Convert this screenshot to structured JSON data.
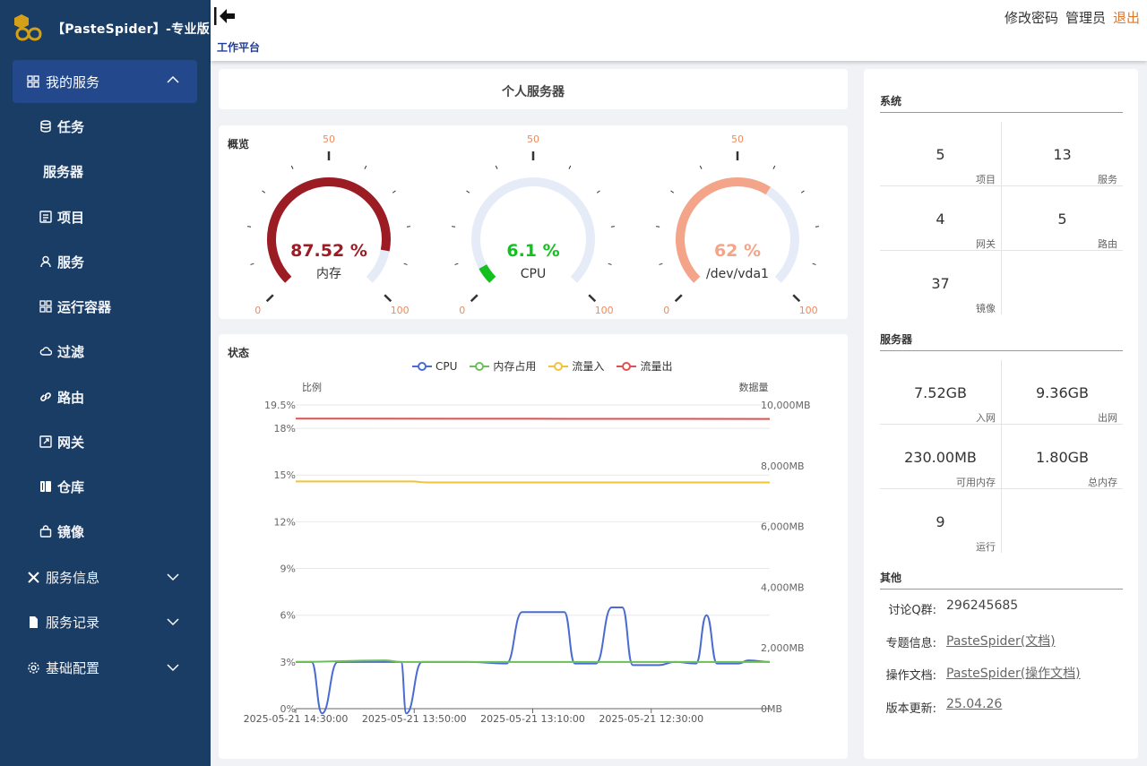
{
  "brand": {
    "title": "【PasteSpider】-专业版",
    "logo_color": "#d4a017"
  },
  "sidebar": {
    "group": {
      "label": "我的服务",
      "icon": "grid-icon"
    },
    "items": [
      {
        "label": "任务",
        "icon": "database-icon"
      },
      {
        "label": "服务器",
        "icon": ""
      },
      {
        "label": "项目",
        "icon": "list-icon"
      },
      {
        "label": "服务",
        "icon": "person-icon"
      },
      {
        "label": "运行容器",
        "icon": "grid-icon"
      },
      {
        "label": "过滤",
        "icon": "cloud-icon"
      },
      {
        "label": "路由",
        "icon": "link-icon"
      },
      {
        "label": "网关",
        "icon": "external-icon"
      },
      {
        "label": "仓库",
        "icon": "book-icon"
      },
      {
        "label": "镜像",
        "icon": "bag-icon"
      }
    ],
    "sections": [
      {
        "label": "服务信息",
        "icon": "tools-icon"
      },
      {
        "label": "服务记录",
        "icon": "file-icon"
      },
      {
        "label": "基础配置",
        "icon": "gear-icon"
      }
    ],
    "bg_color": "#1a3d66",
    "active_color": "#23488b"
  },
  "topbar": {
    "breadcrumb": "工作平台",
    "links": {
      "change_password": "修改密码",
      "admin": "管理员",
      "logout": "退出"
    }
  },
  "server_card": {
    "title": "个人服务器"
  },
  "overview": {
    "title": "概览",
    "gauges": [
      {
        "value": "87.52 %",
        "percent": 87.52,
        "name": "内存",
        "color": "#9c1c24",
        "min": "0",
        "mid": "50",
        "max": "100"
      },
      {
        "value": "6.1 %",
        "percent": 6.1,
        "name": "CPU",
        "color": "#12c01f",
        "min": "0",
        "mid": "50",
        "max": "100"
      },
      {
        "value": "62 %",
        "percent": 62,
        "name": "/dev/vda1",
        "color": "#f4a488",
        "min": "0",
        "mid": "50",
        "max": "100"
      }
    ]
  },
  "status": {
    "title": "状态",
    "chart_data": {
      "type": "line",
      "y_left_label": "比例",
      "y_right_label": "数据量",
      "y_left_ticks": [
        "0%",
        "3%",
        "6%",
        "9%",
        "12%",
        "15%",
        "18%",
        "19.5%"
      ],
      "y_left_range": [
        0,
        19.5
      ],
      "y_right_ticks": [
        "0MB",
        "2,000MB",
        "4,000MB",
        "6,000MB",
        "8,000MB",
        "10,000MB"
      ],
      "y_right_range": [
        0,
        10000
      ],
      "x_ticks": [
        "2025-05-21 14:30:00",
        "2025-05-21 13:50:00",
        "2025-05-21 13:10:00",
        "2025-05-21 12:30:00"
      ],
      "x_count": 90,
      "grid": true,
      "legend_position": "top-center",
      "series": [
        {
          "name": "CPU",
          "color": "#4a6bd0",
          "axis": "left",
          "points": [
            [
              0,
              3.0
            ],
            [
              3,
              3.0
            ],
            [
              5,
              -0.3
            ],
            [
              8,
              3.0
            ],
            [
              13,
              3.0
            ],
            [
              20,
              3.0
            ],
            [
              21,
              -0.3
            ],
            [
              24,
              3.0
            ],
            [
              33,
              3.0
            ],
            [
              40,
              2.9
            ],
            [
              43,
              6.2
            ],
            [
              51,
              6.2
            ],
            [
              53,
              2.9
            ],
            [
              57,
              2.9
            ],
            [
              60,
              6.5
            ],
            [
              62,
              6.5
            ],
            [
              64,
              2.8
            ],
            [
              69,
              2.8
            ],
            [
              72,
              3.0
            ],
            [
              76,
              2.9
            ],
            [
              78,
              6.0
            ],
            [
              80,
              2.9
            ],
            [
              84,
              2.9
            ],
            [
              86,
              3.1
            ],
            [
              90,
              3.0
            ]
          ]
        },
        {
          "name": "内存占用",
          "color": "#6cbf5a",
          "axis": "left",
          "points": [
            [
              0,
              3.0
            ],
            [
              17,
              3.1
            ],
            [
              20,
              3.0
            ],
            [
              90,
              3.0
            ]
          ]
        },
        {
          "name": "流量入",
          "color": "#f2c23b",
          "axis": "right",
          "points": [
            [
              0,
              7480
            ],
            [
              22,
              7480
            ],
            [
              25,
              7450
            ],
            [
              90,
              7450
            ]
          ]
        },
        {
          "name": "流量出",
          "color": "#e05050",
          "axis": "right",
          "points": [
            [
              0,
              9550
            ],
            [
              90,
              9540
            ]
          ]
        }
      ]
    }
  },
  "system": {
    "title": "系统",
    "stats": [
      {
        "value": "5",
        "label": "项目"
      },
      {
        "value": "13",
        "label": "服务"
      },
      {
        "value": "4",
        "label": "网关"
      },
      {
        "value": "5",
        "label": "路由"
      },
      {
        "value": "37",
        "label": "镜像"
      }
    ]
  },
  "server": {
    "title": "服务器",
    "stats": [
      {
        "value": "7.52GB",
        "label": "入网"
      },
      {
        "value": "9.36GB",
        "label": "出网"
      },
      {
        "value": "230.00MB",
        "label": "可用内存"
      },
      {
        "value": "1.80GB",
        "label": "总内存"
      },
      {
        "value": "9",
        "label": "运行"
      }
    ]
  },
  "other": {
    "title": "其他",
    "rows": [
      {
        "label": "讨论Q群:",
        "value": "296245685",
        "link": false
      },
      {
        "label": "专题信息:",
        "value": "PasteSpider(文档)",
        "link": true
      },
      {
        "label": "操作文档:",
        "value": "PasteSpider(操作文档)",
        "link": true
      },
      {
        "label": "版本更新:",
        "value": "25.04.26",
        "link": true
      }
    ]
  }
}
